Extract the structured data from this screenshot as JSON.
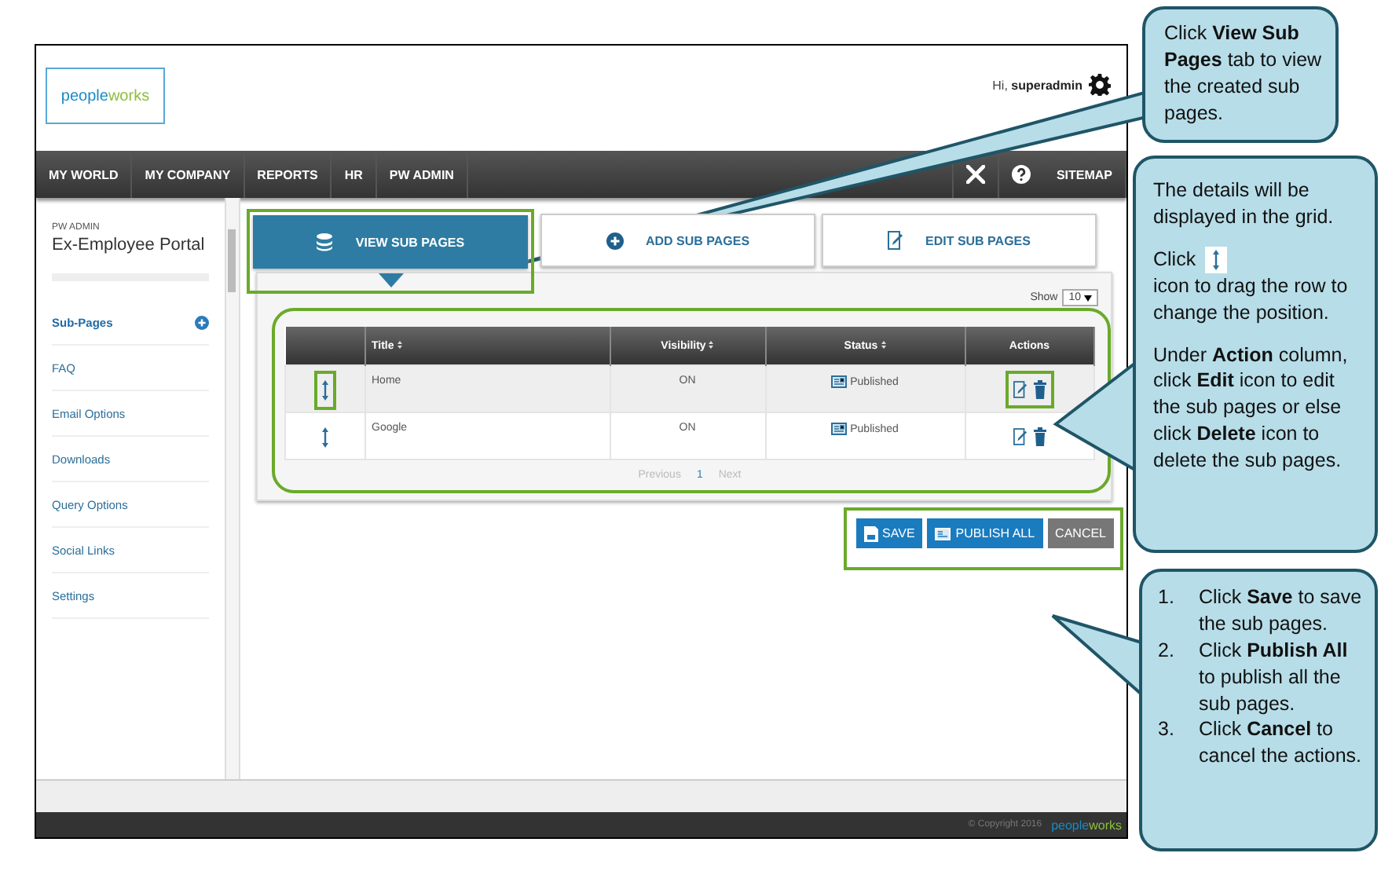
{
  "header": {
    "logo": "peopleworks",
    "greeting": "Hi,",
    "user": "superadmin"
  },
  "nav": {
    "items": [
      "MY WORLD",
      "MY COMPANY",
      "REPORTS",
      "HR",
      "PW ADMIN"
    ],
    "sitemap": "SITEMAP"
  },
  "sidebar": {
    "section": "PW ADMIN",
    "title": "Ex-Employee Portal",
    "items": [
      {
        "label": "Sub-Pages",
        "selected": true
      },
      {
        "label": "FAQ",
        "selected": false
      },
      {
        "label": "Email Options",
        "selected": false
      },
      {
        "label": "Downloads",
        "selected": false
      },
      {
        "label": "Query Options",
        "selected": false
      },
      {
        "label": "Social Links",
        "selected": false
      },
      {
        "label": "Settings",
        "selected": false
      }
    ]
  },
  "tabs": [
    {
      "label": "VIEW SUB PAGES",
      "kind": "view",
      "selected": true,
      "highlighted": true
    },
    {
      "label": "ADD SUB PAGES",
      "kind": "add",
      "selected": false,
      "highlighted": false
    },
    {
      "label": "EDIT SUB PAGES",
      "kind": "edit",
      "selected": false,
      "highlighted": false
    }
  ],
  "grid": {
    "show_label": "Show",
    "page_size": "10",
    "highlighted": true,
    "columns": [
      "Title",
      "Visibility",
      "Status",
      "Actions"
    ],
    "rows": [
      {
        "title": "Home",
        "visibility": "ON",
        "status": "Published",
        "highlighted": true
      },
      {
        "title": "Google",
        "visibility": "ON",
        "status": "Published",
        "highlighted": false
      }
    ],
    "pagination": {
      "previous": "Previous",
      "page": "1",
      "next": "Next"
    }
  },
  "buttons": {
    "highlighted": true,
    "items": [
      {
        "label": "SAVE",
        "kind": "save"
      },
      {
        "label": "PUBLISH ALL",
        "kind": "publish"
      },
      {
        "label": "CANCEL",
        "kind": "cancel"
      }
    ]
  },
  "footer": {
    "copyright": "© Copyright 2016",
    "logo": "peopleworks"
  },
  "callouts": [
    {
      "kind": "text",
      "paragraphs": [
        "Click **View Sub Pages** tab to view the created sub pages."
      ]
    },
    {
      "kind": "details",
      "paragraphs": [
        "The details will be displayed in the grid."
      ],
      "drag_before": "Click",
      "drag_after": "icon to drag the row to change the position.",
      "note": "Under **Action** column, click **Edit** icon to edit the sub pages or else click **Delete** icon to delete the sub pages."
    },
    {
      "kind": "steps",
      "steps": [
        {
          "number": "1.",
          "text": "Click **Save** to save the sub pages."
        },
        {
          "number": "2.",
          "text": "Click **Publish All** to publish all the sub pages."
        },
        {
          "number": "3.",
          "text": "Click **Cancel** to cancel the actions."
        }
      ]
    }
  ]
}
